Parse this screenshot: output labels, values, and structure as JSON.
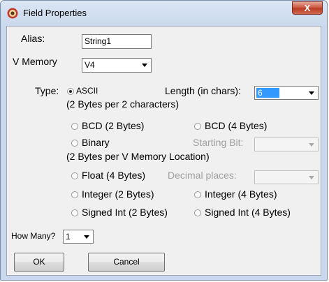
{
  "window": {
    "title": "Field Properties",
    "close_glyph": "X"
  },
  "icons": {
    "app": "app-icon",
    "close": "close-icon",
    "dropdown": "chevron-down-icon"
  },
  "alias": {
    "label": "Alias:",
    "value": "String1"
  },
  "vmemory": {
    "label": "V Memory",
    "value": "V4"
  },
  "type": {
    "label": "Type:",
    "selected": "ascii",
    "options": {
      "ascii": {
        "label": "ASCII",
        "sub": "(2 Bytes per 2 characters)"
      },
      "bcd2": {
        "label": "BCD (2 Bytes)"
      },
      "bcd4": {
        "label": "BCD (4 Bytes)"
      },
      "binary": {
        "label": "Binary",
        "sub": "(2 Bytes per V Memory Location)"
      },
      "float4": {
        "label": "Float (4 Bytes)"
      },
      "int2": {
        "label": "Integer (2 Bytes)"
      },
      "int4": {
        "label": "Integer (4 Bytes)"
      },
      "sint2": {
        "label": "Signed Int (2 Bytes)"
      },
      "sint4": {
        "label": "Signed Int (4 Bytes)"
      }
    }
  },
  "length": {
    "label": "Length (in chars):",
    "value": "6"
  },
  "starting_bit": {
    "label": "Starting Bit:",
    "value": ""
  },
  "decimal_places": {
    "label": "Decimal places:",
    "value": ""
  },
  "how_many": {
    "label": "How Many?",
    "value": "1"
  },
  "buttons": {
    "ok": "OK",
    "cancel": "Cancel"
  },
  "colors": {
    "title_bar": "#c9d8ec",
    "close": "#c7503b",
    "selection": "#3399ff",
    "disabled_text": "#a0a0a0"
  }
}
